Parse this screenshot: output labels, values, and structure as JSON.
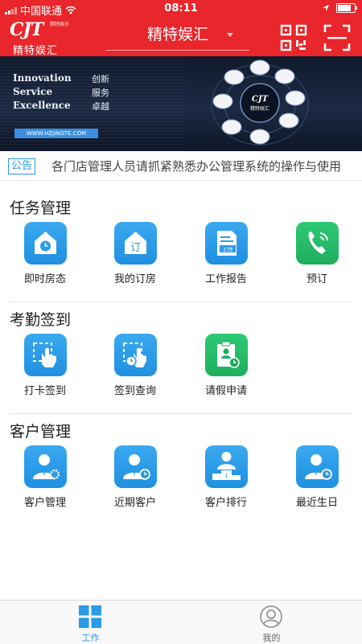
{
  "status_bar": {
    "carrier": "中国联通",
    "time": "08:11",
    "battery_level": 0.9
  },
  "header": {
    "logo_mark": "CJT",
    "logo_small": "精特娱乐",
    "logo_name": "精特娱汇",
    "title": "精特娱汇",
    "qr_icon": "qr-code-icon",
    "scan_icon": "scan-icon"
  },
  "banner": {
    "lines": [
      {
        "en": "Innovation",
        "cn": "创新"
      },
      {
        "en": "Service",
        "cn": "服务"
      },
      {
        "en": "Excellence",
        "cn": "卓越"
      }
    ],
    "url": "WWW.HZJINGTE.COM",
    "center_logo": "精特娱汇"
  },
  "notice": {
    "tag": "公告",
    "text": "各门店管理人员请抓紧熟悉办公管理系统的操作与使用"
  },
  "sections": [
    {
      "title": "任务管理",
      "items": [
        {
          "label": "即时房态",
          "icon": "house-clock-icon"
        },
        {
          "label": "我的订房",
          "icon": "house-booking-icon"
        },
        {
          "label": "工作报告",
          "icon": "work-report-icon"
        },
        {
          "label": "预订",
          "icon": "phone-icon"
        }
      ]
    },
    {
      "title": "考勤签到",
      "items": [
        {
          "label": "打卡签到",
          "icon": "tap-checkin-icon"
        },
        {
          "label": "签到查询",
          "icon": "checkin-query-icon"
        },
        {
          "label": "请假申请",
          "icon": "leave-request-icon"
        }
      ]
    },
    {
      "title": "客户管理",
      "items": [
        {
          "label": "客户管理",
          "icon": "customer-settings-icon"
        },
        {
          "label": "近期客户",
          "icon": "recent-customer-icon"
        },
        {
          "label": "客户排行",
          "icon": "customer-ranking-icon"
        },
        {
          "label": "最近生日",
          "icon": "birthday-icon"
        }
      ]
    }
  ],
  "tabbar": {
    "tabs": [
      {
        "label": "工作",
        "icon": "grid-icon",
        "active": true
      },
      {
        "label": "我的",
        "icon": "profile-icon",
        "active": false
      }
    ]
  },
  "colors": {
    "brand_red": "#e8262b",
    "accent_blue": "#2a9be6",
    "icon_green": "#1fae5f"
  }
}
